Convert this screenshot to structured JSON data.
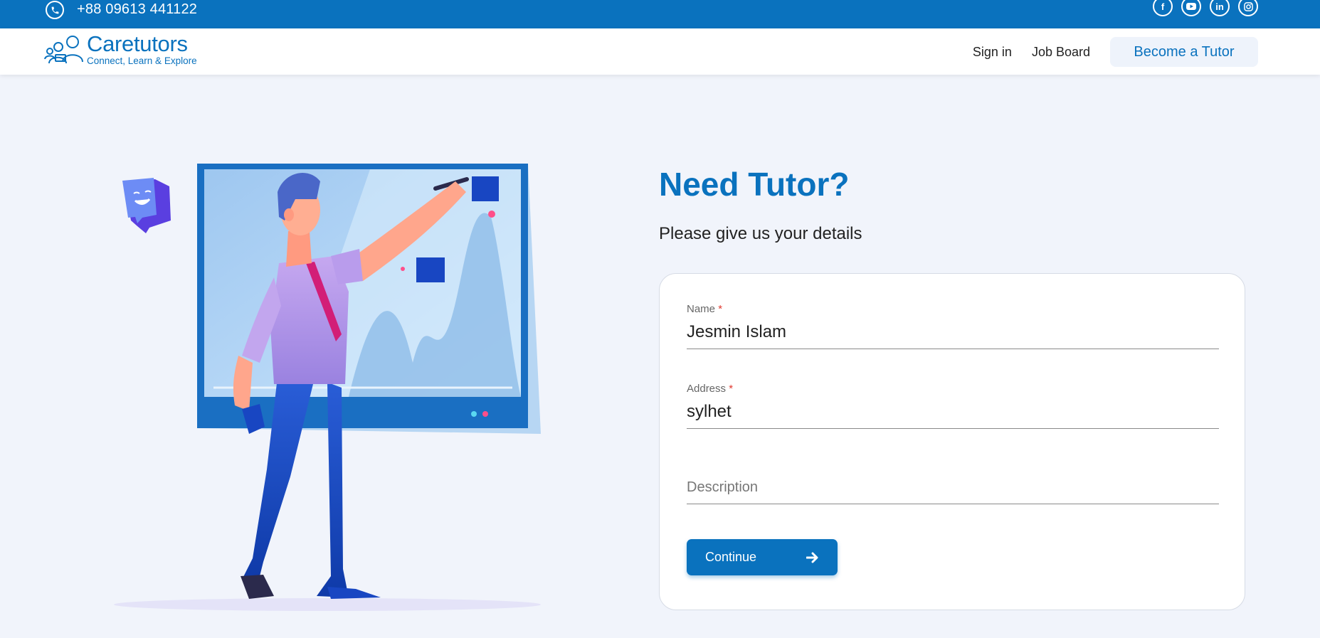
{
  "topbar": {
    "phone": "+88 09613 441122",
    "socials": [
      "facebook-icon",
      "youtube-icon",
      "linkedin-icon",
      "instagram-icon"
    ]
  },
  "brand": {
    "name": "Caretutors",
    "tagline": "Connect, Learn & Explore",
    "color": "#0a72be"
  },
  "nav": {
    "sign_in": "Sign in",
    "job_board": "Job Board",
    "become_tutor": "Become a Tutor"
  },
  "hero": {
    "title": "Need Tutor?",
    "subtitle": "Please give us your details"
  },
  "form": {
    "name_label": "Name",
    "name_value": "Jesmin Islam",
    "address_label": "Address",
    "address_value": "sylhet",
    "description_placeholder": "Description",
    "required_mark": "*",
    "continue_label": "Continue"
  },
  "colors": {
    "primary": "#0a72be",
    "background": "#f1f4fb",
    "required": "#e0392f"
  }
}
